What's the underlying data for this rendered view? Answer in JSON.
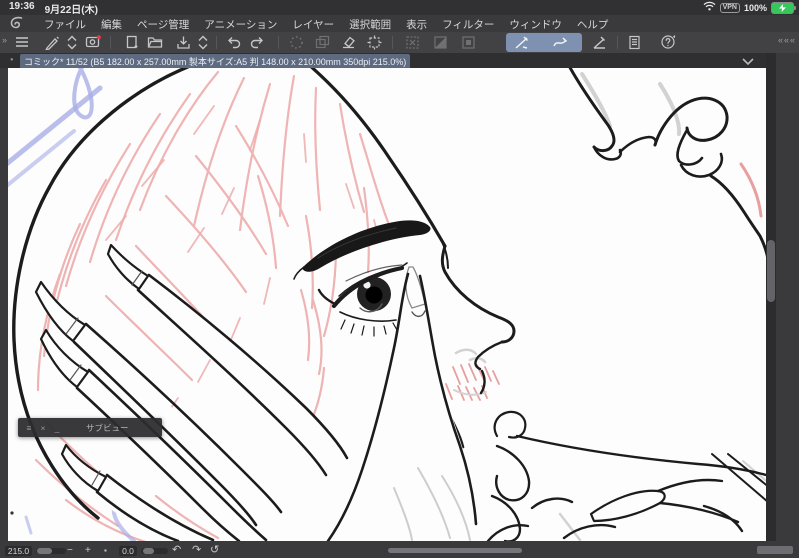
{
  "status_bar": {
    "time": "19:36",
    "date": "9月22日(木)",
    "vpn_label": "VPN",
    "battery_percent": "100%",
    "icons": [
      "wifi-icon",
      "battery-icon"
    ]
  },
  "menu_bar": {
    "logo": "clip-studio-logo",
    "items": [
      {
        "label": "ファイル"
      },
      {
        "label": "編集"
      },
      {
        "label": "ページ管理"
      },
      {
        "label": "アニメーション"
      },
      {
        "label": "レイヤー"
      },
      {
        "label": "選択範囲"
      },
      {
        "label": "表示"
      },
      {
        "label": "フィルター"
      },
      {
        "label": "ウィンドウ"
      },
      {
        "label": "ヘルプ"
      }
    ]
  },
  "toolbar": {
    "collapse_left_glyph": "»",
    "overflow_right_glyph": "«««",
    "help_glyph": "?",
    "icons": [
      "hamburger",
      "pen-tool",
      "tool-switcher",
      "app-window",
      "new-page",
      "open-folder",
      "save",
      "page-switcher",
      "undo",
      "redo",
      "processing",
      "layer-ops",
      "eraser-clear",
      "frame-crop",
      "deselect",
      "invert-selection",
      "selection-fill",
      "snap-linear-ruler",
      "snap-special-ruler",
      "snap-grid",
      "material-list",
      "quick-help"
    ],
    "selected_tools": [
      "snap-linear-ruler",
      "snap-special-ruler"
    ],
    "selection_color": "#7e91b1"
  },
  "title_bar": {
    "bullet": "●",
    "document_tab": "コミック* 11/52 (B5 182.00 x 257.00mm 製本サイズ:A5 判 148.00 x 210.00mm 350dpi 215.0%)",
    "tab_highlight_color": "#5d6a80"
  },
  "subview_panel": {
    "menu_glyph": "≡",
    "close_glyph": "×",
    "minimize_glyph": "_",
    "title": "サブビュー"
  },
  "bottom_bar": {
    "zoom_value": "215.0",
    "zoom_out_glyph": "−",
    "zoom_in_glyph": "+",
    "fit_glyph": "▪",
    "rotation_value": "0.0",
    "rotate_ccw_glyph": "↶",
    "rotate_cw_glyph": "↷",
    "reset_view_glyph": "↺"
  },
  "artwork": {
    "description": "Manga line-art close-up: profile face with detailed eye and eyebrow, clawed hand with long pointed nails touching lower eyelid, second face profile upper right, second clawed hand lower right, pink and purple rough sketch lines",
    "ink_color": "#1c1c1c",
    "sketch_pink": "#edacac",
    "sketch_purple": "#a9aee6",
    "canvas_color": "#fdfdfd"
  }
}
